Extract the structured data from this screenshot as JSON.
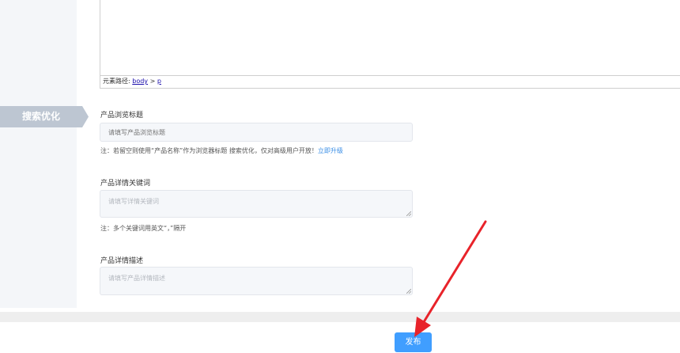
{
  "editor": {
    "path_label": "元素路径:",
    "path_body": "body",
    "path_sep": ">",
    "path_p": "p"
  },
  "section": {
    "tab_label": "搜索优化"
  },
  "seo": {
    "browse_title": {
      "label": "产品浏览标题",
      "placeholder": "请填写产品浏览标题",
      "note_prefix": "注：若留空则使用“产品名称”作为浏览器标题  搜索优化，仅对高级用户开放！",
      "note_link": "立即升级"
    },
    "keywords": {
      "label": "产品详情关键词",
      "placeholder": "请填写详情关键词",
      "note": "注：多个关键词用英文“，”隔开"
    },
    "description": {
      "label": "产品详情描述",
      "placeholder": "请填写产品详情描述"
    }
  },
  "footer": {
    "publish_label": "发布"
  },
  "colors": {
    "tab": "#bdc6d2",
    "primary": "#409eff",
    "annotation_arrow": "#e8232a",
    "link": "#3a8ee6"
  }
}
